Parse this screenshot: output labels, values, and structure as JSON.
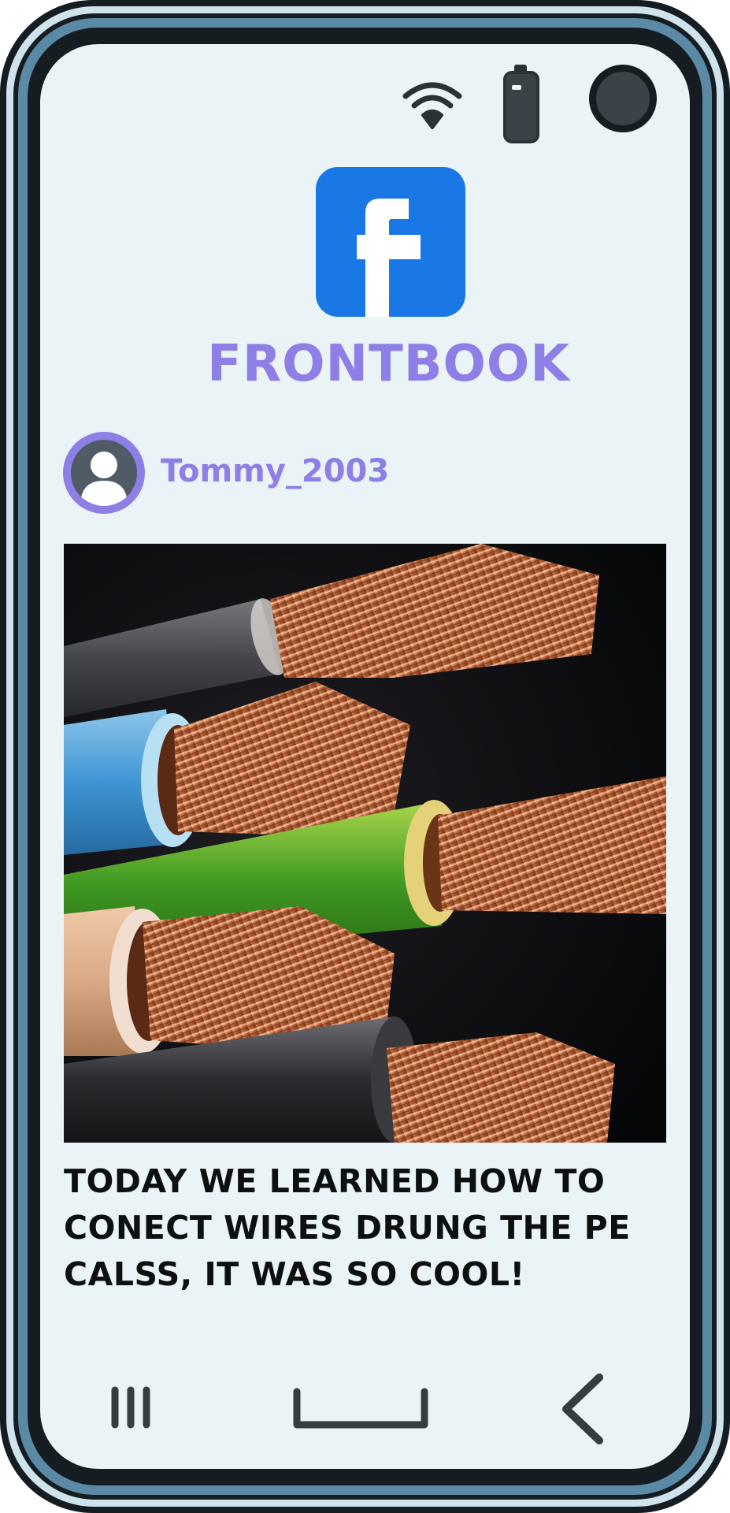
{
  "status_bar": {
    "icons": [
      "wifi-icon",
      "battery-icon",
      "camera-icon"
    ]
  },
  "app": {
    "name": "FRONTBOOK",
    "logo_icon": "frontbook-logo",
    "brand_color": "#1a77e6",
    "accent_color": "#8e7fe6"
  },
  "post": {
    "username": "Tommy_2003",
    "avatar_icon": "user-icon",
    "photo": "copper-wires-photo",
    "caption": "Today we learned how to conect wires drung the PE calss, it was so cool!"
  },
  "nav_bar": {
    "icons": [
      "recents-icon",
      "home-icon",
      "back-icon"
    ]
  }
}
